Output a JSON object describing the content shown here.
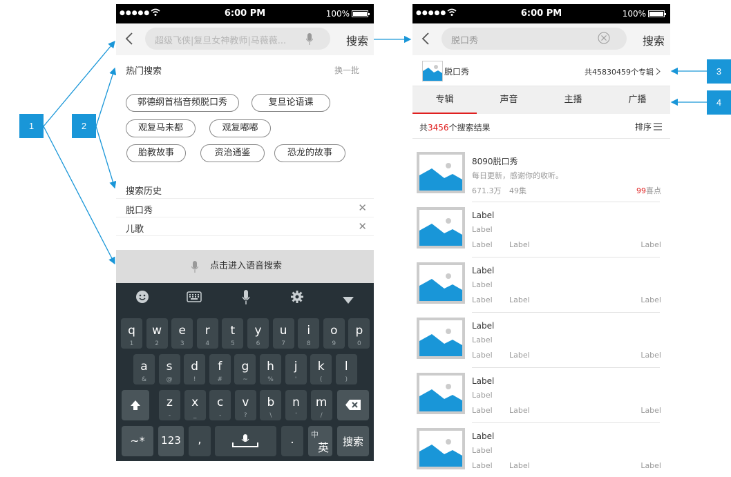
{
  "status_bar": {
    "signal": "●●●●●",
    "time": "6:00 PM",
    "battery": "100%"
  },
  "left": {
    "search_placeholder": "超级飞侠|复旦女神教师|马薇薇...",
    "search_button": "搜索",
    "hot_title": "热门搜索",
    "refresh": "换一批",
    "hot_tags": [
      "郭德纲首档音频脱口秀",
      "复旦论语课",
      "观复马未都",
      "观复嘟嘟",
      "胎教故事",
      "资治通鉴",
      "恐龙的故事"
    ],
    "history_title": "搜索历史",
    "history": [
      "脱口秀",
      "儿歌"
    ],
    "voice_search": "点击进入语音搜索",
    "keyboard": {
      "row1": [
        [
          "q",
          "1"
        ],
        [
          "w",
          "2"
        ],
        [
          "e",
          "3"
        ],
        [
          "r",
          "4"
        ],
        [
          "t",
          "5"
        ],
        [
          "y",
          "6"
        ],
        [
          "u",
          "7"
        ],
        [
          "i",
          "8"
        ],
        [
          "o",
          "9"
        ],
        [
          "p",
          "0"
        ]
      ],
      "row2": [
        [
          "a",
          "&"
        ],
        [
          "s",
          "@"
        ],
        [
          "d",
          "!"
        ],
        [
          "f",
          "#"
        ],
        [
          "g",
          "~"
        ],
        [
          "h",
          "%"
        ],
        [
          "j",
          "'"
        ],
        [
          "k",
          "("
        ],
        [
          "l",
          ")"
        ]
      ],
      "row3": [
        [
          "z",
          "-"
        ],
        [
          "x",
          "_"
        ],
        [
          "c",
          "-"
        ],
        [
          "v",
          "?"
        ],
        [
          "b",
          "\\"
        ],
        [
          "n",
          "'"
        ],
        [
          "m",
          "/"
        ]
      ],
      "sym": "~*",
      "num": "123",
      "comma": ",",
      "period": ".",
      "lang_top": "中",
      "lang_bottom": "英",
      "search": "搜索"
    }
  },
  "right": {
    "search_value": "脱口秀",
    "search_button": "搜索",
    "banner_title": "脱口秀",
    "banner_count": "共45830459个专辑",
    "tabs": [
      "专辑",
      "声音",
      "主播",
      "广播"
    ],
    "result_prefix": "共",
    "result_count": "3456",
    "result_suffix": "个搜索结果",
    "sort": "排序",
    "results": [
      {
        "title": "8090脱口秀",
        "sub": "每日更新，感谢你的收听。",
        "plays": "671.3万",
        "episodes": "49集",
        "likes_num": "99",
        "likes_text": "喜点"
      },
      {
        "title": "Label",
        "sub": "Label",
        "plays": "Label",
        "episodes": "Label",
        "likes_num": "",
        "likes_text": "Label"
      },
      {
        "title": "Label",
        "sub": "Label",
        "plays": "Label",
        "episodes": "Label",
        "likes_num": "",
        "likes_text": "Label"
      },
      {
        "title": "Label",
        "sub": "Label",
        "plays": "Label",
        "episodes": "Label",
        "likes_num": "",
        "likes_text": "Label"
      },
      {
        "title": "Label",
        "sub": "Label",
        "plays": "Label",
        "episodes": "Label",
        "likes_num": "",
        "likes_text": "Label"
      },
      {
        "title": "Label",
        "sub": "Label",
        "plays": "Label",
        "episodes": "Label",
        "likes_num": "",
        "likes_text": "Label"
      }
    ]
  },
  "callouts": [
    "1",
    "2",
    "3",
    "4"
  ],
  "colors": {
    "accent_blue": "#1996d8",
    "red": "#e02020",
    "keyboard_bg": "#273137"
  }
}
